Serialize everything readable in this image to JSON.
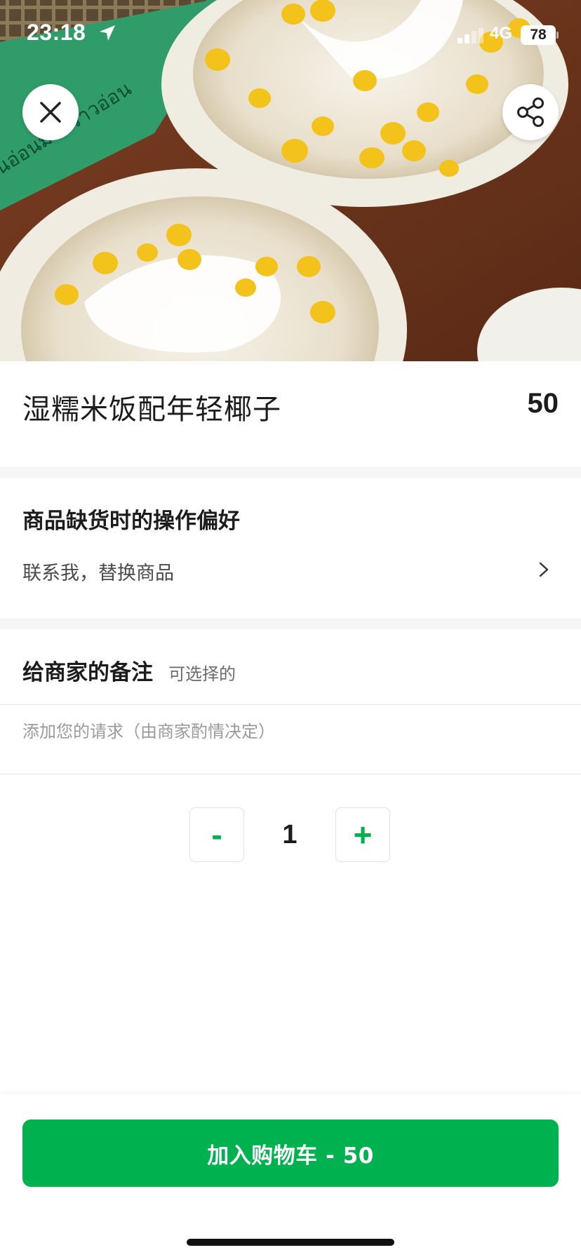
{
  "status_bar": {
    "time": "23:18",
    "network": "4G",
    "battery": "78"
  },
  "hero": {
    "close_icon": "close-icon",
    "share_icon": "share-icon",
    "packaging_text": "นอ่อนมะพร้าวอ่อน"
  },
  "product": {
    "title": "湿糯米饭配年轻椰子",
    "price": "50"
  },
  "out_of_stock": {
    "heading": "商品缺货时的操作偏好",
    "value": "联系我，替换商品"
  },
  "note": {
    "heading": "给商家的备注",
    "optional_label": "可选择的",
    "placeholder": "添加您的请求（由商家酌情决定）"
  },
  "quantity": {
    "minus_label": "-",
    "value": "1",
    "plus_label": "+"
  },
  "cart_button": {
    "label": "加入购物车 - 50"
  },
  "colors": {
    "brand_green": "#00b14f",
    "divider_gray": "#f5f5f5"
  }
}
